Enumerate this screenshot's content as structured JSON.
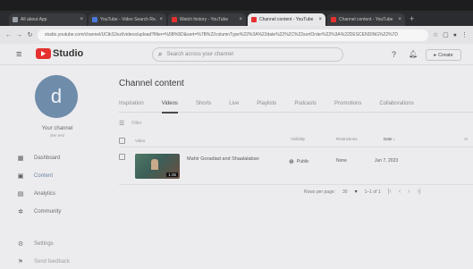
{
  "browser": {
    "tabs": [
      {
        "label": "All about App",
        "color": "#9aa0a6",
        "active": false
      },
      {
        "label": "YouTube - Video Search Re...",
        "color": "#4a78d8",
        "active": false
      },
      {
        "label": "Watch history - YouTube",
        "color": "#e53030",
        "active": false
      },
      {
        "label": "Channel content - YouTube",
        "color": "#e53030",
        "active": true
      },
      {
        "label": "Channel content - YouTube",
        "color": "#e53030",
        "active": false
      }
    ],
    "new_tab": "+",
    "url": "studio.youtube.com/channel/UCtkS3xzl/videos/upload?filter=%5B%5D&sort=%7B%22columnType%22%3A%22date%22%2C%22sortOrder%22%3A%22DESCENDING%22%7D"
  },
  "header": {
    "logo_text": "Studio",
    "search_placeholder": "Search across your channel",
    "create_label": "Create"
  },
  "sidebar": {
    "avatar_letter": "d",
    "channel_name": "Your channel",
    "channel_sub": "dee test",
    "items": [
      {
        "label": "Dashboard",
        "icon": "dashboard-icon",
        "glyph": "▦"
      },
      {
        "label": "Content",
        "icon": "content-icon",
        "glyph": "▣",
        "active": true
      },
      {
        "label": "Analytics",
        "icon": "analytics-icon",
        "glyph": "▤"
      },
      {
        "label": "Community",
        "icon": "community-icon",
        "glyph": "✲"
      },
      {
        "label": "Settings",
        "icon": "settings-icon",
        "glyph": "⚙"
      },
      {
        "label": "Send feedback",
        "icon": "feedback-icon",
        "glyph": "⚑"
      }
    ]
  },
  "main": {
    "title": "Channel content",
    "tabs": [
      {
        "label": "Inspiration",
        "active": false
      },
      {
        "label": "Videos",
        "active": true
      },
      {
        "label": "Shorts",
        "active": false
      },
      {
        "label": "Live",
        "active": false
      },
      {
        "label": "Playlists",
        "active": false
      },
      {
        "label": "Podcasts",
        "active": false
      },
      {
        "label": "Promotions",
        "active": false
      },
      {
        "label": "Collaborations",
        "active": false
      }
    ],
    "filter_placeholder": "Filter",
    "columns": {
      "video": "Video",
      "visibility": "Visibility",
      "restrictions": "Restrictions",
      "date": "Date ↓",
      "views": "Vi"
    },
    "rows": [
      {
        "title": "Mahir Goradiad and Shaalalaban",
        "duration": "1:36",
        "visibility": "Public",
        "restrictions": "None",
        "date": "Jun 7, 2023"
      }
    ],
    "pager": {
      "rows_label": "Rows per page:",
      "rows_value": "30",
      "range": "1–1 of 1"
    }
  }
}
